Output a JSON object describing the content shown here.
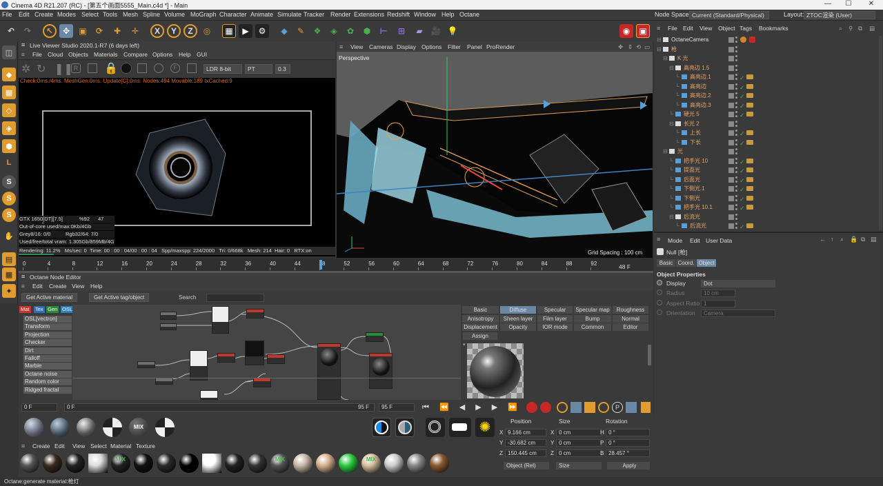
{
  "window": {
    "title": "Cinema 4D R21.207 (RC) - [第五个画面5555_Main.c4d *] - Main"
  },
  "menu": [
    "File",
    "Edit",
    "Create",
    "Modes",
    "Select",
    "Tools",
    "Mesh",
    "Spline",
    "Volume",
    "MoGraph",
    "Character",
    "Animate",
    "Simulate",
    "Tracker",
    "Render",
    "Extensions",
    "Redshift",
    "Window",
    "Help",
    "Octane"
  ],
  "node_space": {
    "label": "Node Space:",
    "value": "Current (Standard/Physical)"
  },
  "layout": {
    "label": "Layout:",
    "value": "ZTOC渲染 (User)"
  },
  "toolbar": {
    "x": "X",
    "y": "Y",
    "z": "Z"
  },
  "live_viewer": {
    "title": "Live Viewer Studio 2020.1-R7 (6 days left)",
    "menu": [
      "File",
      "Cloud",
      "Objects",
      "Materials",
      "Compare",
      "Options",
      "Help",
      "GUI"
    ],
    "ldr": "LDR 8-bit",
    "mode": "PT",
    "value": "0.3",
    "status": "Check:0ms./4ms. MeshGen:0ms. Update[C]:0ms. Nodes:494 Movable:189 txCached:9",
    "gpu": "GTX 1650[DT][7.5]",
    "gpu_pct": "%92",
    "gpu_temp": "47",
    "outofcore": "Out-of-core used/max:0Kb/4Gb",
    "grey": "Grey8/16: 0/0",
    "rgb": "Rgb32/64: 7/0",
    "vram": "Used/free/total vram: 1.305Gb/859Mb/4Gb",
    "rendering": "Rendering: 11.2%",
    "mssec": "Ms/sec: 0",
    "time": "Time: 00 : 00 : 04/00 : 00 : 04",
    "spp": "Spp/maxspp: 224/2000",
    "tri": "Tri: 0/668k",
    "mesh": "Mesh: 214",
    "hair": "Hair: 0",
    "rtx": "RTX:on"
  },
  "viewport": {
    "menu": [
      "View",
      "Cameras",
      "Display",
      "Options",
      "Filter",
      "Panel",
      "ProRender"
    ],
    "label": "Perspective",
    "grid": "Grid Spacing : 100 cm"
  },
  "timeline": {
    "ticks": [
      "0",
      "4",
      "8",
      "12",
      "16",
      "20",
      "24",
      "28",
      "32",
      "36",
      "40",
      "44",
      "48",
      "52",
      "56",
      "60",
      "64",
      "68",
      "72",
      "76",
      "80",
      "84",
      "88",
      "92"
    ],
    "current": "48 F"
  },
  "node_editor": {
    "title": "Octane Node Editor",
    "menu": [
      "Edit",
      "Create",
      "View",
      "Help"
    ],
    "get_material": "Get Active material",
    "get_tag": "Get Active tag/object",
    "search_label": "Search",
    "cats": [
      {
        "t": "Mat",
        "c": "#c0392b"
      },
      {
        "t": "Tex",
        "c": "#2e6fb5"
      },
      {
        "t": "Gen",
        "c": "#2a8a3a"
      },
      {
        "t": "OSL",
        "c": "#2f7fb8"
      },
      {
        "t": "Map",
        "c": "#a0306e"
      },
      {
        "t": "Oth",
        "c": "#5a5a5a"
      },
      {
        "t": "Ems",
        "c": "#7a3a9a"
      },
      {
        "t": "Med",
        "c": "#2a8a7a"
      },
      {
        "t": "C4D",
        "c": "#1f1f1f"
      }
    ],
    "items": [
      "OSL[vectron]",
      "Transform",
      "Projection",
      "Checker",
      "Dirt",
      "Falloff",
      "Marble",
      "Octane noise",
      "Random color",
      "Ridged fractal"
    ],
    "tabs_row1": [
      "Basic",
      "Diffuse",
      "Specular",
      "Specular map",
      "Roughness"
    ],
    "tabs_row2": [
      "Anisotropy",
      "Sheen layer",
      "Film layer",
      "Bump",
      "Normal"
    ],
    "tabs_row3": [
      "Displacement",
      "Opacity",
      "IOR mode",
      "Common",
      "Editor"
    ],
    "assign": "Assign"
  },
  "objects": {
    "menu": [
      "File",
      "Edit",
      "View",
      "Object",
      "Tags",
      "Bookmarks"
    ],
    "items": [
      {
        "name": "OctaneCamera",
        "indent": 0,
        "white": true
      },
      {
        "name": "枪",
        "indent": 0,
        "white": false
      },
      {
        "name": "K 光",
        "indent": 1,
        "white": false
      },
      {
        "name": "高亮边 1.5",
        "indent": 2,
        "white": false
      },
      {
        "name": "高亮边.1",
        "indent": 3,
        "white": false,
        "light": true
      },
      {
        "name": "高亮边",
        "indent": 3,
        "white": false,
        "light": true
      },
      {
        "name": "高亮边.2",
        "indent": 3,
        "white": false,
        "light": true
      },
      {
        "name": "高亮边.3",
        "indent": 3,
        "white": false,
        "light": true
      },
      {
        "name": "硬光 5",
        "indent": 2,
        "white": false,
        "light": true
      },
      {
        "name": "长光 2",
        "indent": 2,
        "white": false
      },
      {
        "name": "上长",
        "indent": 3,
        "white": false,
        "light": true
      },
      {
        "name": "下长",
        "indent": 3,
        "white": false,
        "light": true
      },
      {
        "name": "光",
        "indent": 1,
        "white": false
      },
      {
        "name": "把手光 10",
        "indent": 2,
        "white": false,
        "light": true
      },
      {
        "name": "提面光",
        "indent": 2,
        "white": false,
        "light": true
      },
      {
        "name": "后面光",
        "indent": 2,
        "white": false,
        "light": true
      },
      {
        "name": "下侧光.1",
        "indent": 2,
        "white": false,
        "light": true
      },
      {
        "name": "下侧光",
        "indent": 2,
        "white": false,
        "light": true
      },
      {
        "name": "把手光 10.1",
        "indent": 2,
        "white": false,
        "light": true
      },
      {
        "name": "后流光",
        "indent": 2,
        "white": false
      },
      {
        "name": "后流光",
        "indent": 3,
        "white": false,
        "light": true
      }
    ]
  },
  "attributes": {
    "menu": [
      "Mode",
      "Edit",
      "User Data"
    ],
    "object": "Null [枪]",
    "tabs": [
      "Basic",
      "Coord.",
      "Object"
    ],
    "section": "Object Properties",
    "display_label": "Display",
    "display_value": "Dot",
    "radius_label": "Radius",
    "radius_value": "10 cm",
    "aspect_label": "Aspect Ratio",
    "aspect_value": "1",
    "orientation_label": "Orientation",
    "orientation_value": "Camera"
  },
  "transport": {
    "start": "0 F",
    "start2": "0 F",
    "end": "95 F",
    "end2": "95 F"
  },
  "materials": {
    "menu": [
      "Create",
      "Edit",
      "View",
      "Select",
      "Material",
      "Texture"
    ],
    "mix": "MIX"
  },
  "coords": {
    "headers": [
      "Position",
      "Size",
      "Rotation"
    ],
    "rows": [
      {
        "a": "X",
        "p": "9.166 cm",
        "b": "X",
        "s": "0 cm",
        "c": "H",
        "r": "0 °"
      },
      {
        "a": "Y",
        "p": "-30.682 cm",
        "b": "Y",
        "s": "0 cm",
        "c": "P",
        "r": "0 °"
      },
      {
        "a": "Z",
        "p": "150.445 cm",
        "b": "Z",
        "s": "0 cm",
        "c": "B",
        "r": "28.457 °"
      }
    ],
    "mode": "Object (Rel)",
    "size": "Size",
    "apply": "Apply"
  },
  "status": "Octane:generate material:枪灯"
}
